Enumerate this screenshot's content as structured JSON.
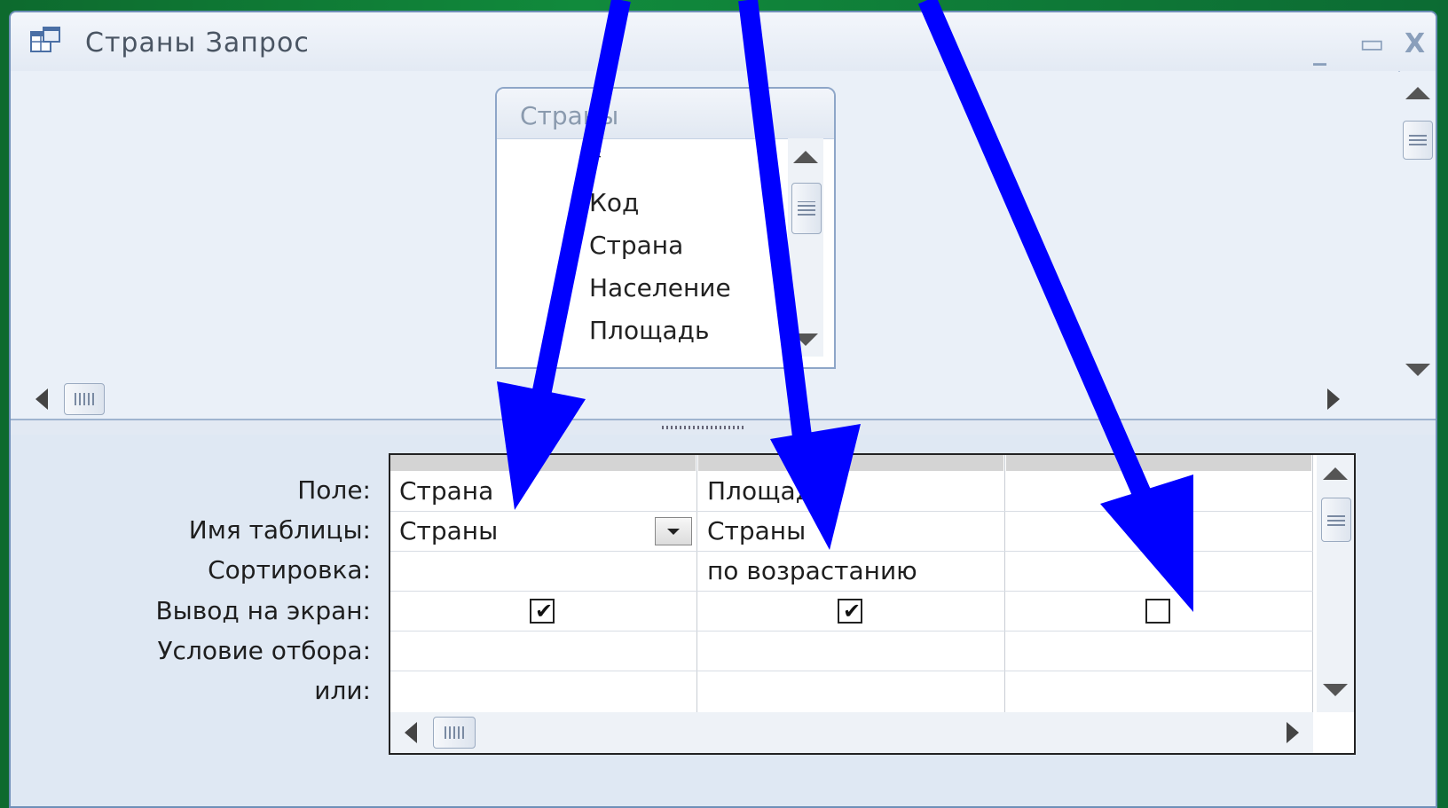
{
  "window": {
    "title": "Страны Запрос",
    "controls": {
      "minimize": "_",
      "maximize": "▭",
      "close": "X"
    },
    "icon": "query-design-icon"
  },
  "table_box": {
    "title": "Страны",
    "fields": [
      "*",
      "Код",
      "Страна",
      "Население",
      "Площадь"
    ]
  },
  "design_grid": {
    "row_labels": [
      "Поле:",
      "Имя таблицы:",
      "Сортировка:",
      "Вывод на экран:",
      "Условие отбора:",
      "или:"
    ],
    "columns": [
      {
        "field": "Страна",
        "table": "Страны",
        "sort": "",
        "show": true,
        "criteria": "",
        "or": ""
      },
      {
        "field": "Площадь",
        "table": "Страны",
        "sort": "по возрастанию",
        "show": true,
        "criteria": "",
        "or": ""
      },
      {
        "field": "",
        "table": "",
        "sort": "",
        "show": false,
        "criteria": "",
        "or": ""
      }
    ]
  },
  "annotation": {
    "arrow_color": "#0000ff"
  },
  "colors": {
    "background_green": "#0d6a2e",
    "window_bg": "#eaf0f8",
    "arrow": "#0000ff"
  }
}
